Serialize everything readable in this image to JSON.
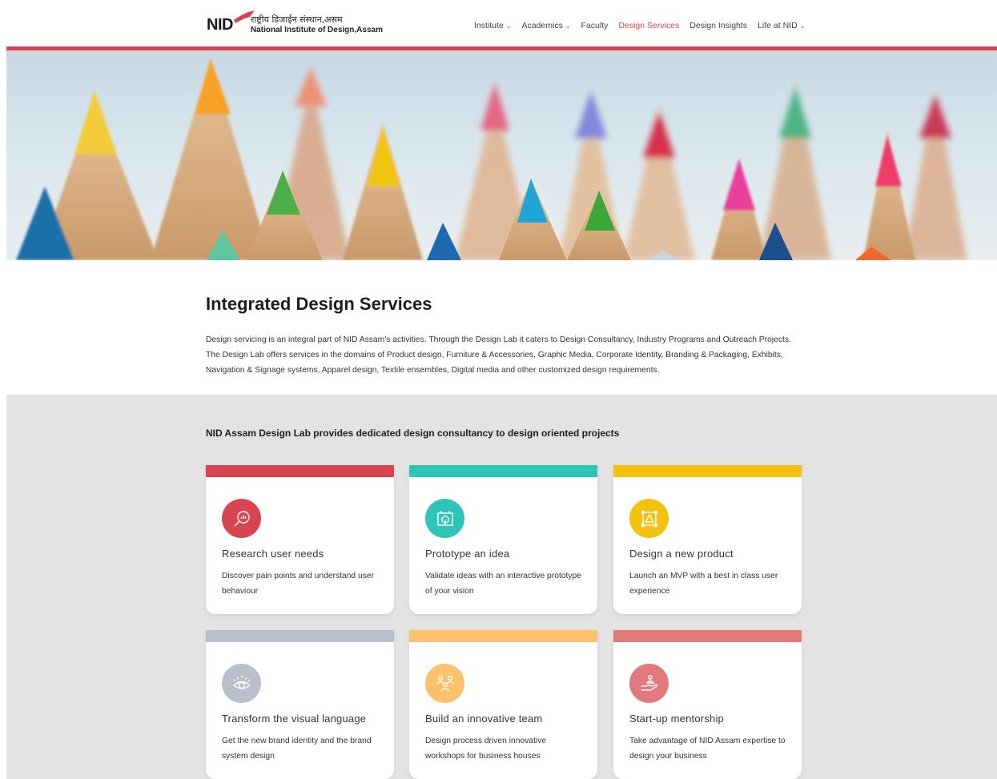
{
  "header": {
    "logo_mark": "NID",
    "logo_hindi": "राष्ट्रीय डिजाईन संस्थान,असम",
    "logo_english": "National Institute of Design,Assam"
  },
  "nav": {
    "items": [
      {
        "label": "Institute",
        "dropdown": true
      },
      {
        "label": "Academics",
        "dropdown": true
      },
      {
        "label": "Faculty",
        "dropdown": false
      },
      {
        "label": "Design Services",
        "dropdown": false,
        "active": true
      },
      {
        "label": "Design Insights",
        "dropdown": false
      },
      {
        "label": "Life at NID",
        "dropdown": true
      }
    ],
    "chevron": "⌄"
  },
  "colors": {
    "accent": "#d94452",
    "red": "#d94452",
    "teal": "#2ec4b6",
    "yellow": "#f2c20f",
    "gray": "#b9c0cb",
    "orange": "#fbc16b",
    "pink": "#e27a7d"
  },
  "intro": {
    "title": "Integrated Design Services",
    "body": "Design servicing is an integral part of NID Assam’s activities. Through the Design Lab it caters to Design Consultancy, Industry Programs and Outreach Projects. The Design Lab offers services in the domains of Product design, Furniture & Accessories, Graphic Media, Corporate Identity, Branding & Packaging, Exhibits, Navigation & Signage systems, Apparel design, Textile ensembles, Digital media and other customized design requirements."
  },
  "services": {
    "heading": "NID Assam Design Lab provides dedicated design consultancy to design oriented projects",
    "cards": [
      {
        "title": "Research user needs",
        "desc": "Discover pain points and understand user behaviour",
        "icon": "research-icon",
        "color": "#d94452"
      },
      {
        "title": "Prototype an idea",
        "desc": "Validate ideas with an interactive prototype of your vision",
        "icon": "prototype-icon",
        "color": "#2ec4b6"
      },
      {
        "title": "Design a new product",
        "desc": "Launch an MVP with a best in class user experience",
        "icon": "product-design-icon",
        "color": "#f2c20f"
      },
      {
        "title": "Transform the visual language",
        "desc": "Get the new brand identity and the brand system design",
        "icon": "eye-icon",
        "color": "#b9c0cb"
      },
      {
        "title": "Build an innovative team",
        "desc": "Design process driven innovative workshops for business houses",
        "icon": "team-icon",
        "color": "#fbc16b"
      },
      {
        "title": "Start-up mentorship",
        "desc": "Take advantage of NID Assam expertise to design your business",
        "icon": "mentorship-icon",
        "color": "#e27a7d"
      }
    ]
  }
}
